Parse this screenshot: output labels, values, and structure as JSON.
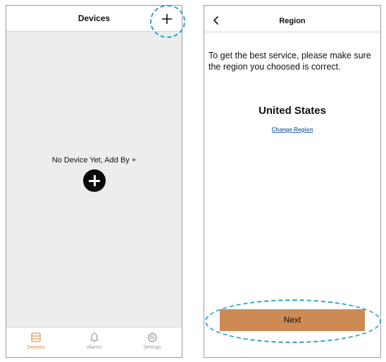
{
  "devices_screen": {
    "title": "Devices",
    "empty_message": "No Device Yet, Add By +",
    "tabs": [
      {
        "label": "Devices",
        "icon": "devices-icon",
        "active": true
      },
      {
        "label": "Alarms",
        "icon": "bell-icon",
        "active": false
      },
      {
        "label": "Settings",
        "icon": "gear-icon",
        "active": false
      }
    ]
  },
  "region_screen": {
    "title": "Region",
    "instruction": "To get the best service, please make sure the region you choosed is correct.",
    "region": "United States",
    "change_link": "Change Region",
    "next_label": "Next"
  },
  "colors": {
    "accent": "#cd8a55",
    "active_tab": "#d4884b",
    "link": "#3a6ea8",
    "callout": "#2aa3c7",
    "empty_background": "#ededee"
  }
}
